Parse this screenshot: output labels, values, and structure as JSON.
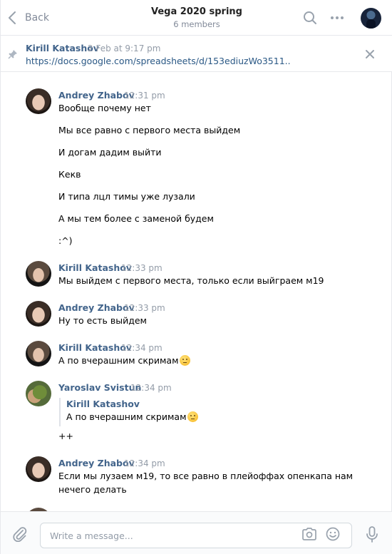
{
  "header": {
    "back_label": "Back",
    "title": "Vega 2020 spring",
    "subtitle": "6 members"
  },
  "pinned": {
    "author": "Kirill Katashov",
    "time": "2 Feb at 9:17 pm",
    "link": "https://docs.google.com/spreadsheets/d/153ediuzWo3511.."
  },
  "messages": [
    {
      "author": "Andrey Zhabov",
      "time": "12:31 pm",
      "lines": [
        "Вообще почему нет",
        "Мы все равно с первого места выйдем",
        "И догам дадим выйти",
        "Кекв",
        "И типа лцл тимы уже лузали",
        "А мы тем более с заменой будем",
        ":^)"
      ]
    },
    {
      "author": "Kirill Katashov",
      "time": "12:33 pm",
      "lines": [
        "Мы выйдем с первого места, только если выйграем м19"
      ]
    },
    {
      "author": "Andrey Zhabov",
      "time": "12:33 pm",
      "lines": [
        "Ну то есть выйдем"
      ]
    },
    {
      "author": "Kirill Katashov",
      "time": "12:34 pm",
      "lines": [
        "А по вчерашним скримам"
      ]
    },
    {
      "author": "Yaroslav Svistun",
      "time": "12:34 pm",
      "quote_author": "Kirill Katashov",
      "quote_text": "А по вчерашним скримам",
      "lines": [
        "++"
      ]
    },
    {
      "author": "Andrey Zhabov",
      "time": "12:34 pm",
      "lines": [
        "Если мы лузаем м19, то все равно в плейоффах опенкапа нам",
        "нечего делать"
      ]
    }
  ],
  "composer": {
    "placeholder": "Write a message..."
  },
  "icons": {
    "back": "chevron-left-icon",
    "search": "search-icon",
    "more": "more-dots-icon",
    "pin": "pin-icon",
    "close": "close-icon",
    "attach": "paperclip-icon",
    "camera": "camera-icon",
    "emoji": "smile-icon",
    "mic": "microphone-icon"
  },
  "colors": {
    "link": "#2a5885",
    "author": "#42648b",
    "muted": "#939ca8"
  }
}
